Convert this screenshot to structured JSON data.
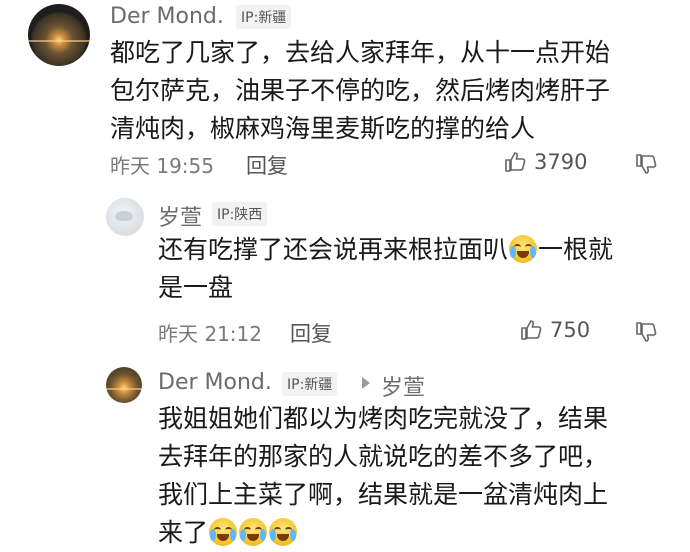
{
  "comments": [
    {
      "author": "Der Mond.",
      "ip": "IP:新疆",
      "lines": [
        "都吃了几家了，去给人家拜年，从十一点开始",
        "包尔萨克，油果子不停的吃，然后烤肉烤肝子",
        "清炖肉，椒麻鸡海里麦斯吃的撑的给人"
      ],
      "time": "昨天 19:55",
      "reply_label": "回复",
      "likes": "3790"
    },
    {
      "author": "岁萱",
      "ip": "IP:陕西",
      "lines": [
        "还有吃撑了还会说再来根拉面叭",
        "一根就",
        "是一盘"
      ],
      "time": "昨天 21:12",
      "reply_label": "回复",
      "likes": "750"
    },
    {
      "author": "Der Mond.",
      "ip": "IP:新疆",
      "reply_to": "岁萱",
      "lines": [
        "我姐姐她们都以为烤肉吃完就没了，结果",
        "去拜年的那家的人就说吃的差不多了吧，",
        "我们上主菜了啊，结果就是一盆清炖肉上",
        "来了"
      ]
    }
  ],
  "icons": {
    "like": "thumbs-up-icon",
    "dislike": "thumbs-down-icon",
    "emoji": "crying-laughing-emoji",
    "reply_arrow": "reply-arrow-icon"
  }
}
